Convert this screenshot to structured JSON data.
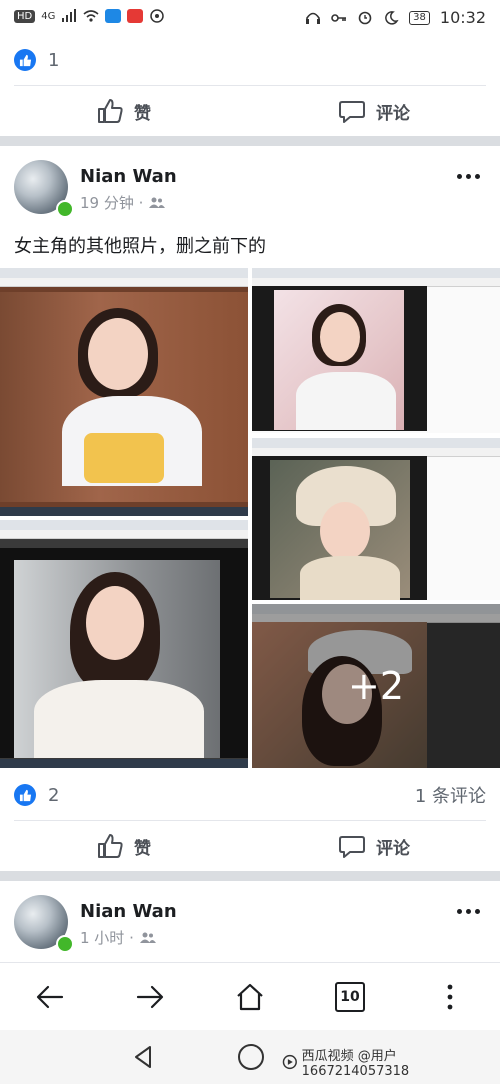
{
  "status_bar": {
    "left_labels": [
      "HD",
      "4G"
    ],
    "battery": "38",
    "time": "10:32"
  },
  "post1_footer": {
    "like_count": "1",
    "like_label": "赞",
    "comment_label": "评论"
  },
  "post2": {
    "author": "Nian Wan",
    "meta": "19 分钟 ·",
    "text": "女主角的其他照片，删之前下的",
    "more_photos": "+2",
    "like_count": "2",
    "comment_count": "1 条评论",
    "like_label": "赞",
    "comment_label": "评论"
  },
  "post3": {
    "author": "Nian Wan",
    "meta": "1 小时 ·"
  },
  "browser_nav": {
    "tab_count": "10"
  },
  "watermark": {
    "text": "西瓜视频 @用户1667214057318"
  },
  "colors": {
    "facebook_blue": "#1877f2",
    "online_green": "#42b72a",
    "divider": "#dadde1"
  }
}
